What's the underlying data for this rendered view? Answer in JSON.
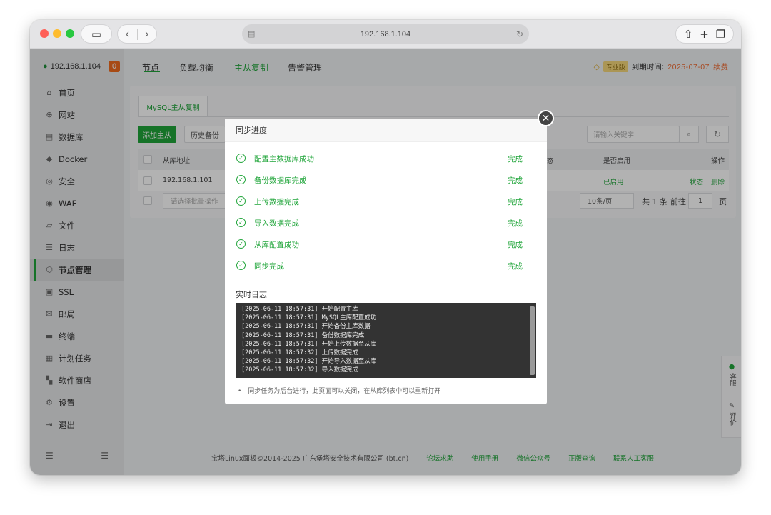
{
  "browser": {
    "url": "192.168.1.104",
    "icons": [
      "sidebar-toggle-icon",
      "back-icon",
      "forward-icon",
      "share-icon",
      "new-tab-icon",
      "tabs-overview-icon"
    ],
    "glyph_back": "‹",
    "glyph_forward": "›",
    "glyph_sidebar": "▭",
    "glyph_share": "⇧",
    "glyph_plus": "+",
    "glyph_tabs": "❐",
    "glyph_site": "▤",
    "glyph_reload": "↻"
  },
  "sidebar": {
    "server_ip": "192.168.1.104",
    "server_badge": "0",
    "items": [
      {
        "label": "首页",
        "icon": "home-icon",
        "glyph": "⌂"
      },
      {
        "label": "网站",
        "icon": "globe-icon",
        "glyph": "⊕"
      },
      {
        "label": "数据库",
        "icon": "database-icon",
        "glyph": "▤"
      },
      {
        "label": "Docker",
        "icon": "docker-icon",
        "glyph": "◆"
      },
      {
        "label": "安全",
        "icon": "shield-check-icon",
        "glyph": "◎"
      },
      {
        "label": "WAF",
        "icon": "waf-shield-icon",
        "glyph": "◉"
      },
      {
        "label": "文件",
        "icon": "folder-icon",
        "glyph": "▱"
      },
      {
        "label": "日志",
        "icon": "log-icon",
        "glyph": "☰"
      },
      {
        "label": "节点管理",
        "icon": "node-icon",
        "glyph": "⬡",
        "active": true
      },
      {
        "label": "SSL",
        "icon": "ssl-icon",
        "glyph": "▣"
      },
      {
        "label": "邮局",
        "icon": "mail-icon",
        "glyph": "✉"
      },
      {
        "label": "终端",
        "icon": "terminal-icon",
        "glyph": "▬"
      },
      {
        "label": "计划任务",
        "icon": "calendar-icon",
        "glyph": "▦"
      },
      {
        "label": "软件商店",
        "icon": "store-icon",
        "glyph": "▚"
      },
      {
        "label": "设置",
        "icon": "settings-icon",
        "glyph": "⚙"
      },
      {
        "label": "退出",
        "icon": "logout-icon",
        "glyph": "⇥"
      }
    ],
    "bottom_left": "☰",
    "bottom_right": "☰"
  },
  "topnav": {
    "tabs": [
      "节点",
      "负载均衡",
      "主从复制",
      "告警管理"
    ],
    "active_tab": "主从复制",
    "vip_badge": "专业版",
    "expire_label": "到期时间:",
    "expire_date": "2025-07-07",
    "renew": "续费"
  },
  "content": {
    "subtab": "MySQL主从复制",
    "add_button": "添加主从",
    "history_button": "历史备份",
    "search_placeholder": "请输入关键字",
    "columns": {
      "addr": "从库地址",
      "status_partial": "态",
      "enabled": "是否启用",
      "ops": "操作"
    },
    "row": {
      "addr": "192.168.1.101",
      "enabled": "已启用",
      "op_status": "状态",
      "op_delete": "删除"
    },
    "batch_placeholder": "请选择批量操作",
    "page_size": "10条/页",
    "total": "共 1 条",
    "goto": "前往",
    "page_num": "1",
    "page_unit": "页"
  },
  "footer": {
    "copyright": "宝塔Linux面板©2014-2025 广东堡塔安全技术有限公司 (bt.cn)",
    "links": [
      "论坛求助",
      "使用手册",
      "微信公众号",
      "正版查询",
      "联系人工客服"
    ]
  },
  "float_panel": {
    "service": "客服",
    "review": "评价"
  },
  "modal": {
    "title": "同步进度",
    "close_glyph": "✕",
    "steps": [
      {
        "label": "配置主数据库成功",
        "status": "完成"
      },
      {
        "label": "备份数据库完成",
        "status": "完成"
      },
      {
        "label": "上传数据完成",
        "status": "完成"
      },
      {
        "label": "导入数据完成",
        "status": "完成"
      },
      {
        "label": "从库配置成功",
        "status": "完成"
      },
      {
        "label": "同步完成",
        "status": "完成"
      }
    ],
    "step_glyph": "✓",
    "log_title": "实时日志",
    "log_lines": [
      "[2025-06-11 18:57:31] 开始配置主库",
      "[2025-06-11 18:57:31] MySQL主库配置成功",
      "[2025-06-11 18:57:31] 开始备份主库数据",
      "[2025-06-11 18:57:31] 备份数据库完成",
      "[2025-06-11 18:57:31] 开始上传数据至从库",
      "[2025-06-11 18:57:32] 上传数据完成",
      "[2025-06-11 18:57:32] 开始导入数据至从库",
      "[2025-06-11 18:57:32] 导入数据完成"
    ],
    "note": "同步任务为后台进行，此页面可以关闭，在从库列表中可以重新打开"
  },
  "colors": {
    "accent": "#20a53a",
    "badge": "#ef6b1e",
    "expire": "#f06b32"
  }
}
